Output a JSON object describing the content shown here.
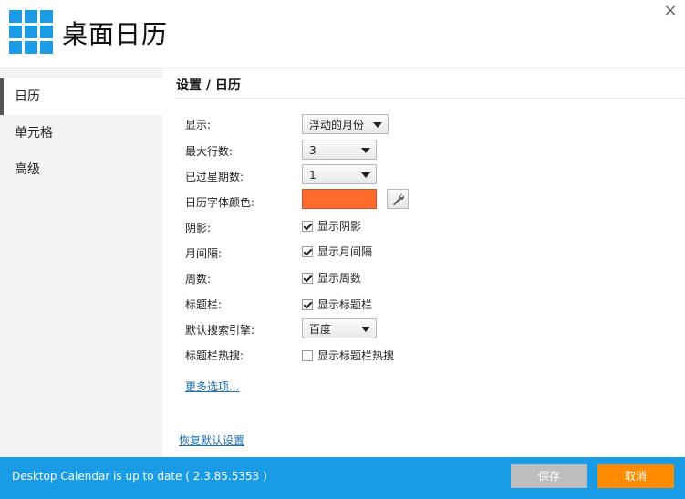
{
  "app": {
    "title": "桌面日历",
    "close_glyph": "×"
  },
  "sidebar": {
    "items": [
      {
        "label": "日历",
        "active": true
      },
      {
        "label": "单元格",
        "active": false
      },
      {
        "label": "高级",
        "active": false
      }
    ]
  },
  "main": {
    "section_title": "设置 / 日历",
    "rows": {
      "display": {
        "label": "显示:",
        "value": "浮动的月份"
      },
      "max_rows": {
        "label": "最大行数:",
        "value": "3"
      },
      "past_weeks": {
        "label": "已过星期数:",
        "value": "1"
      },
      "font_color": {
        "label": "日历字体颜色:",
        "color": "#ff6b2d"
      },
      "shadow": {
        "label": "阴影:",
        "check_label": "显示阴影",
        "checked": true
      },
      "month_gap": {
        "label": "月间隔:",
        "check_label": "显示月间隔",
        "checked": true
      },
      "week_num": {
        "label": "周数:",
        "check_label": "显示周数",
        "checked": true
      },
      "title_bar": {
        "label": "标题栏:",
        "check_label": "显示标题栏",
        "checked": true
      },
      "search_engine": {
        "label": "默认搜索引擎:",
        "value": "百度"
      },
      "title_hot": {
        "label": "标题栏热搜:",
        "check_label": "显示标题栏热搜",
        "checked": false
      }
    },
    "more_options": "更多选项...",
    "restore_defaults": "恢复默认设置"
  },
  "footer": {
    "status": "Desktop Calendar is up to date ( 2.3.85.5353 )",
    "save_label": "保存",
    "cancel_label": "取消"
  },
  "colors": {
    "accent": "#1a9be6",
    "cancel": "#ff8c00",
    "save_disabled": "#bdbdbd"
  },
  "icons": [
    "app-logo-grid-icon",
    "close-icon",
    "chevron-down-icon",
    "wrench-icon",
    "checkmark-icon"
  ]
}
